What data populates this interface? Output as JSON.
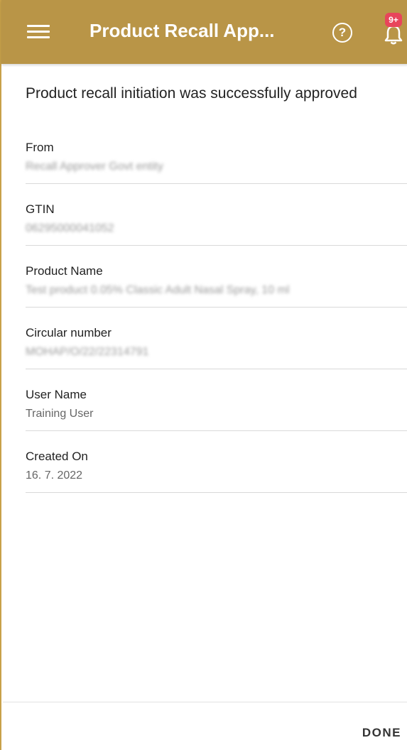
{
  "header": {
    "title": "Product Recall App...",
    "help_glyph": "?",
    "notification_badge": "9+",
    "bar_color": "#b99547",
    "badge_color": "#e8455b"
  },
  "main": {
    "heading": "Product recall initiation was successfully approved",
    "fields": [
      {
        "label": "From",
        "value": "Recall Approver Govt entity"
      },
      {
        "label": "GTIN",
        "value": "06295000041052"
      },
      {
        "label": "Product Name",
        "value": "Test product 0.05% Classic Adult Nasal Spray, 10 ml"
      },
      {
        "label": "Circular number",
        "value": "MOHAP/O/22/22314791"
      },
      {
        "label": "User Name",
        "value": "Training User"
      },
      {
        "label": "Created On",
        "value": "16. 7. 2022"
      }
    ]
  },
  "footer": {
    "done_label": "DONE"
  },
  "icons": [
    "menu-icon",
    "help-icon",
    "bell-icon"
  ]
}
